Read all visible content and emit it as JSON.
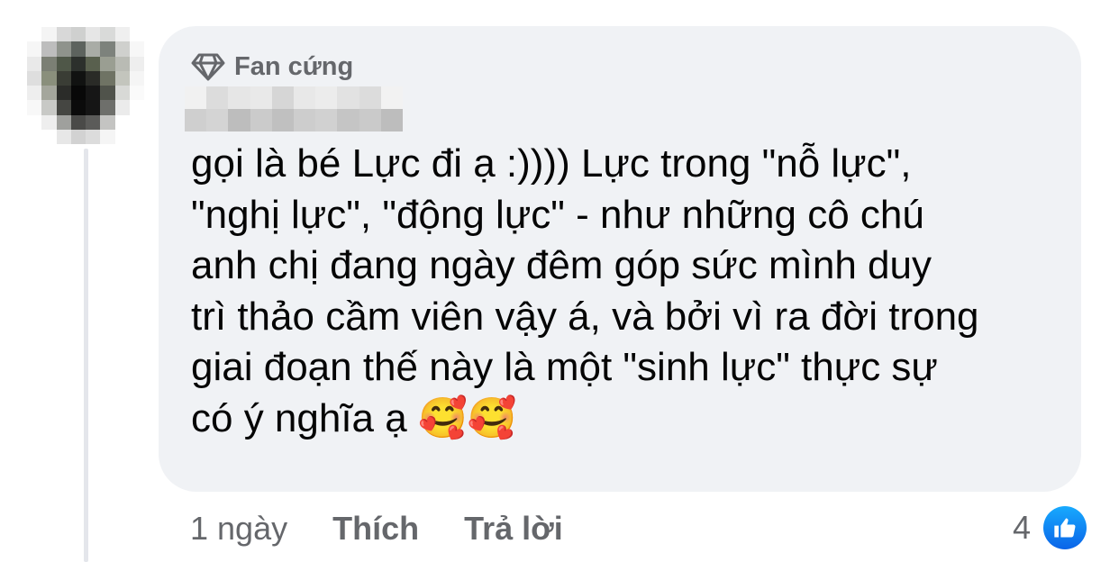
{
  "comment": {
    "badge_label": "Fan cứng",
    "text": "gọi là bé Lực đi ạ :)))) Lực trong \"nỗ lực\",\n\"nghị lực\", \"động lực\" - như những cô chú\nanh chị đang ngày đêm góp sức mình duy\ntrì thảo cầm viên vậy á, và bởi vì ra đời trong\ngiai đoạn thế này là một \"sinh lực\" thực sự\ncó ý nghĩa ạ 🥰🥰",
    "timestamp": "1 ngày",
    "like_label": "Thích",
    "reply_label": "Trả lời",
    "reaction_count": "4"
  },
  "icons": {
    "badge": "diamond-icon",
    "reaction": "like-thumb-icon"
  },
  "colors": {
    "bubble_bg": "#f0f2f5",
    "meta_text": "#65676b",
    "body_text": "#050505",
    "like_blue": "#0a7cff"
  }
}
